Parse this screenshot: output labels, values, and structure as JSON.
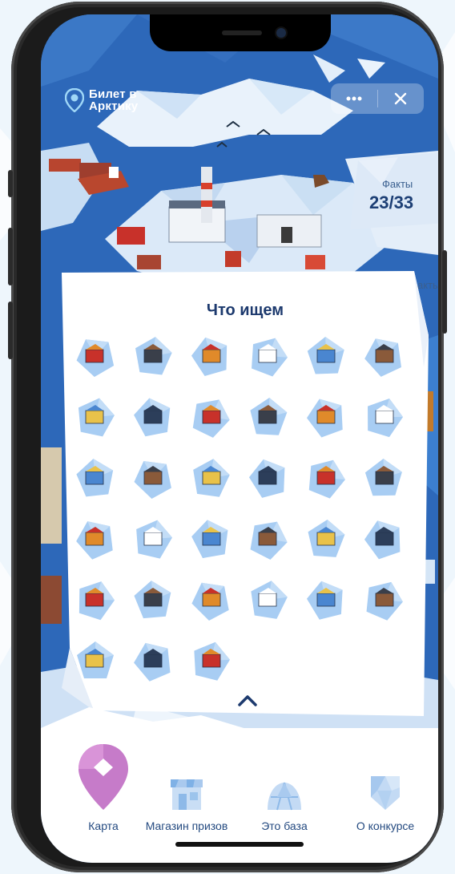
{
  "logo": {
    "line1": "Билет в",
    "line2": "Арктику"
  },
  "top_controls": {
    "more_icon": "more-dots-icon",
    "close_icon": "close-icon"
  },
  "facts": {
    "label": "Факты",
    "value": "23/33",
    "cut_label": "акты"
  },
  "panel": {
    "title": "Что ищем",
    "items": [
      "container-module",
      "polar-station",
      "lighthouse",
      "excavator",
      "ice-shelter",
      "billboard",
      "reindeer-sled",
      "icebreaker-ship",
      "oil-rig",
      "pumpjack",
      "crater",
      "thermometer",
      "rocks",
      "polar-bear",
      "reindeer-tent",
      "walrus",
      "barrels",
      "tundra-flowers",
      "fire-truck",
      "cargo-ship",
      "pipeline",
      "hangar",
      "tanker",
      "cruise-ship",
      "factory",
      "kennel",
      "apartment-block",
      "iceberg",
      "hunter",
      "whale-tail",
      "arctic-person",
      "no-fishing-sign",
      "sun-and-boat"
    ]
  },
  "nav": {
    "items": [
      {
        "label": "Карта",
        "icon": "map-pin-icon"
      },
      {
        "label": "Магазин призов",
        "icon": "shop-icon"
      },
      {
        "label": "Это база",
        "icon": "base-dome-icon"
      },
      {
        "label": "О конкурсе",
        "icon": "about-shield-icon"
      }
    ]
  },
  "colors": {
    "primary": "#1d3a6e",
    "accent": "#c07ac8",
    "ocean": "#2c67b8",
    "ice": "#dcecfb"
  }
}
